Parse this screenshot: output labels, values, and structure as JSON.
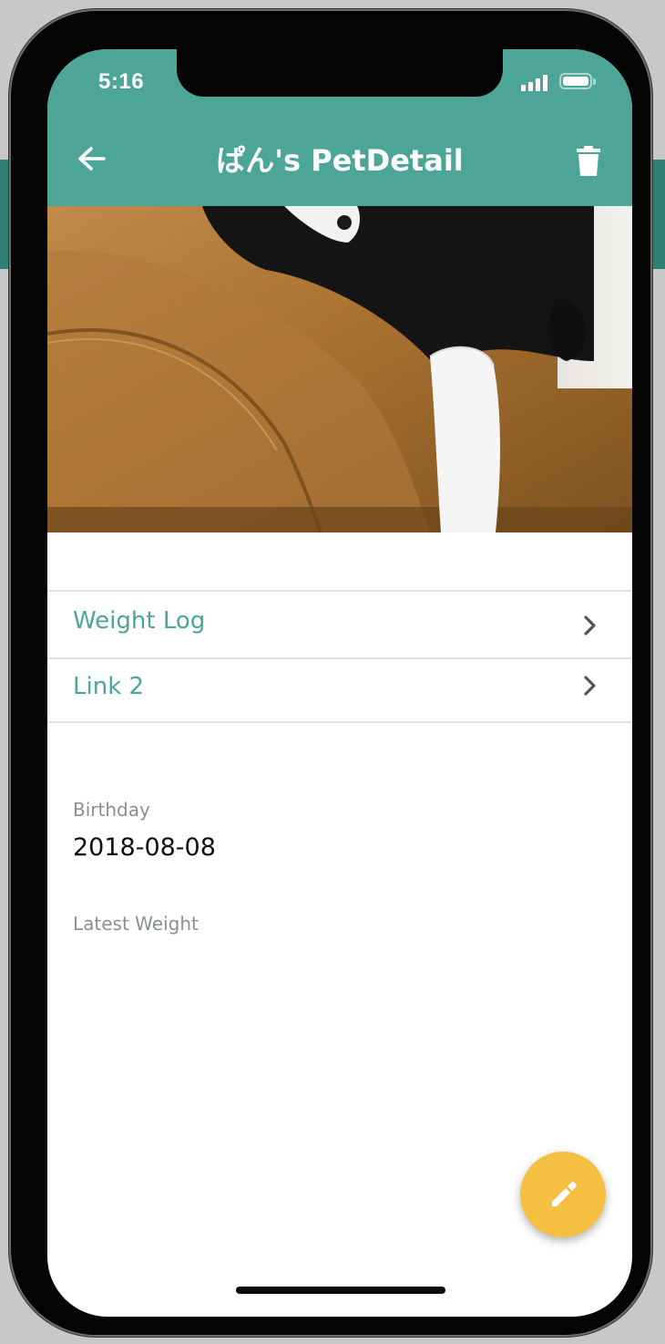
{
  "status_bar": {
    "time": "5:16"
  },
  "appbar": {
    "title": "ぱん's PetDetail",
    "back_icon": "arrow-back-icon",
    "delete_icon": "trash-icon",
    "color": "#4ca597"
  },
  "photo": {
    "subject": "cat-on-sofa-photo"
  },
  "links": [
    {
      "label": "Weight Log",
      "icon": "chevron-right-icon"
    },
    {
      "label": "Link 2",
      "icon": "chevron-right-icon"
    }
  ],
  "fields": {
    "birthday_label": "Birthday",
    "birthday_value": "2018-08-08",
    "latest_weight_label": "Latest Weight"
  },
  "fab": {
    "icon": "pencil-icon",
    "color": "#f5bf42"
  }
}
